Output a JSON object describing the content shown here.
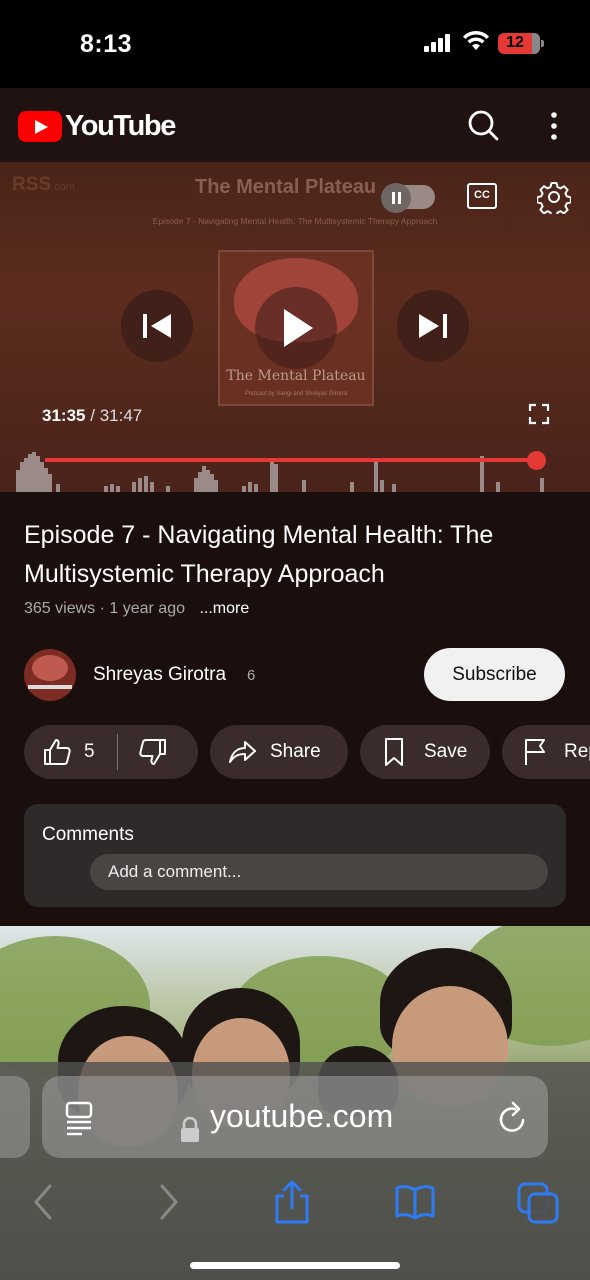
{
  "status_bar": {
    "time": "8:13",
    "battery": "12"
  },
  "header": {
    "brand": "YouTube",
    "search_icon": "search-icon",
    "more_icon": "more-vertical-icon"
  },
  "player": {
    "overlay_brand": "RSS",
    "overlay_brand_suffix": ".com",
    "overlay_title": "The Mental Plateau",
    "overlay_subtitle": "Episode 7 - Navigating Mental Health: The Multisystemic Therapy Approach",
    "art_title": "The Mental Plateau",
    "art_subtitle": "Podcast by Sangi and Shreyas Girotra",
    "current_time": "31:35",
    "separator": "/",
    "duration": "31:47",
    "cc_label": "CC",
    "progress_fraction": 0.994
  },
  "video": {
    "title": "Episode 7 - Navigating Mental Health: The Multisystemic Therapy Approach",
    "views": "365 views",
    "age": "· 1 year ago",
    "more": "...more"
  },
  "channel": {
    "name": "Shreyas Girotra",
    "subscriber_count": "6",
    "subscribe_label": "Subscribe"
  },
  "actions": {
    "likes": "5",
    "share": "Share",
    "save": "Save",
    "report": "Report"
  },
  "comments": {
    "label": "Comments",
    "placeholder": "Add a comment..."
  },
  "browser": {
    "url": "youtube.com"
  },
  "colors": {
    "accent": "#e53935",
    "yt_red": "#ff0000",
    "safari_blue": "#2f7bf5"
  }
}
